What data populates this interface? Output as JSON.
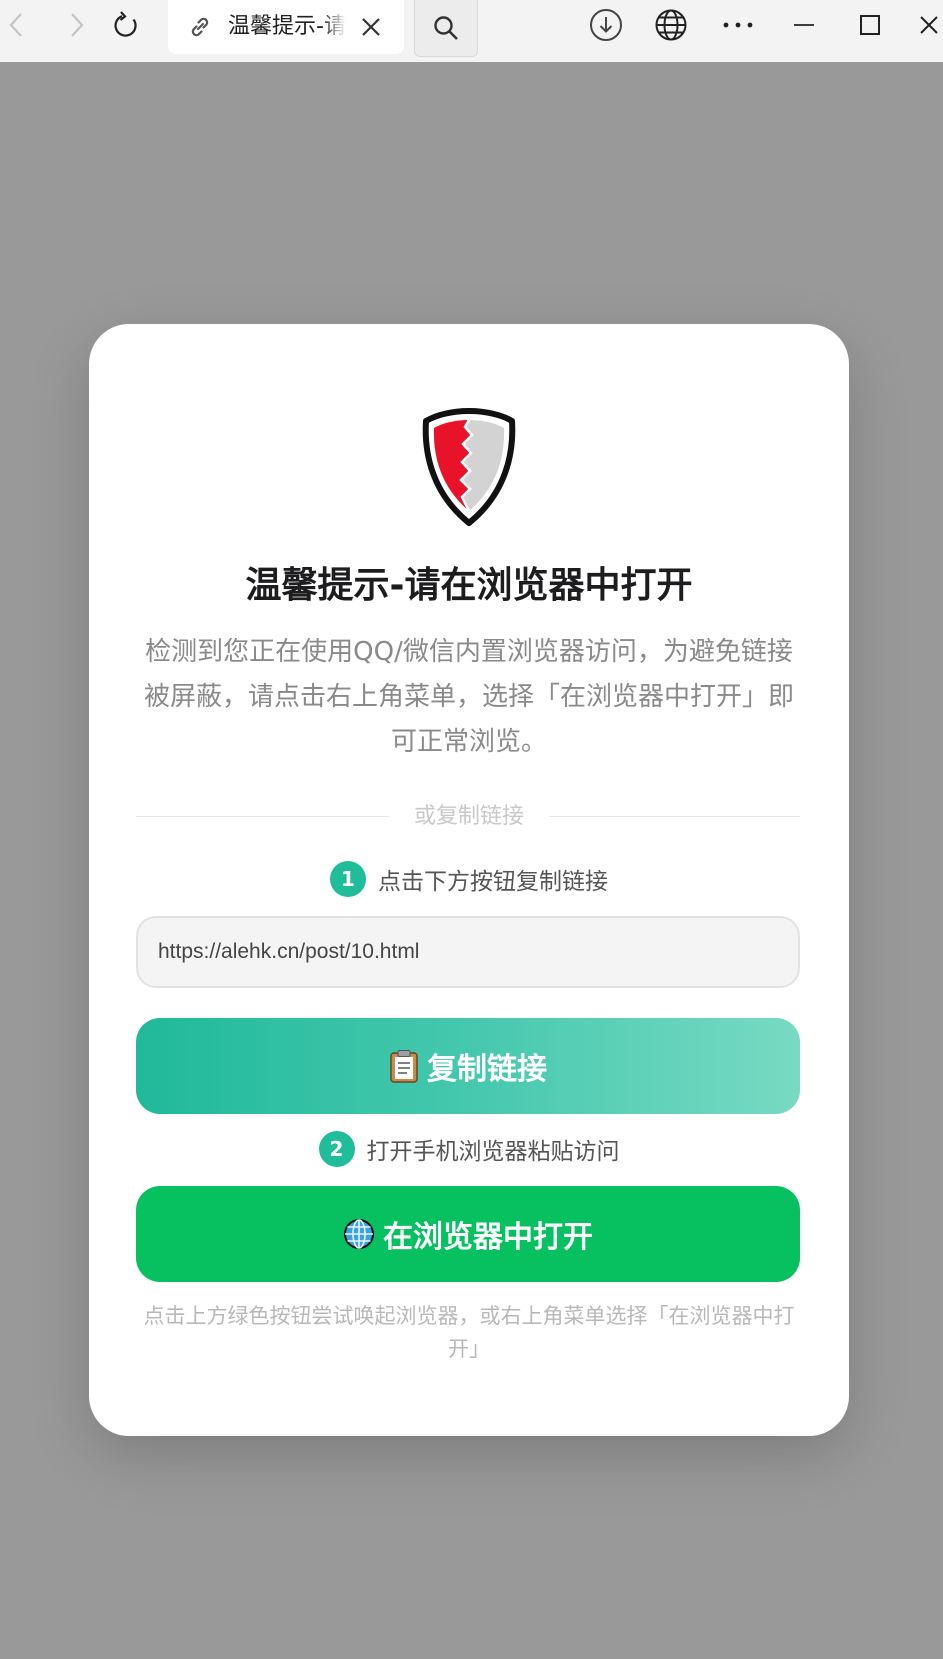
{
  "browser": {
    "tab_title": "温馨提示-请在浏览器中打开",
    "icons": {
      "back": "back-arrow-icon",
      "forward": "forward-arrow-icon",
      "refresh": "refresh-icon",
      "tab_link": "link-icon",
      "tab_close": "close-icon",
      "search": "search-icon",
      "download": "download-icon",
      "globe": "globe-icon",
      "more": "more-icon",
      "minimize": "minimize-icon",
      "maximize": "maximize-icon",
      "close_window": "close-window-icon"
    }
  },
  "dialog": {
    "logo_icon": "shield-icon",
    "title": "温馨提示-请在浏览器中打开",
    "description": "检测到您正在使用QQ/微信内置浏览器访问，为避免链接被屏蔽，请点击右上角菜单，选择「在浏览器中打开」即可正常浏览。",
    "divider_text": "或复制链接",
    "step1": {
      "number": "1",
      "text": "点击下方按钮复制链接"
    },
    "url_value": "https://alehk.cn/post/10.html",
    "copy_button": {
      "icon": "clipboard-icon",
      "label": "复制链接"
    },
    "step2": {
      "number": "2",
      "text": "打开手机浏览器粘贴访问"
    },
    "open_button": {
      "icon": "globe-icon",
      "label": "在浏览器中打开"
    },
    "footnote": "点击上方绿色按钮尝试唤起浏览器，或右上角菜单选择「在浏览器中打开」"
  },
  "colors": {
    "overlay": "#999999",
    "teal_accent": "#1fbd9a",
    "open_button": "#07c160",
    "shield_red": "#e8132a"
  }
}
